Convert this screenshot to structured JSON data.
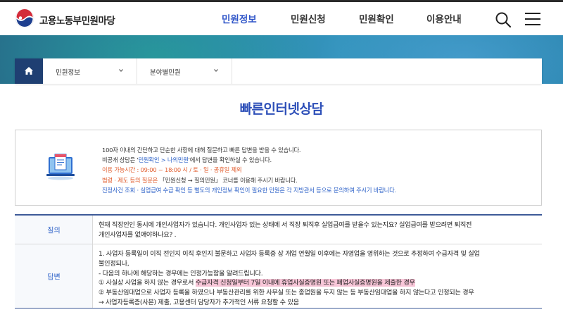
{
  "header": {
    "site_name": "고용노동부민원마당",
    "nav": [
      {
        "label": "민원정보",
        "active": true
      },
      {
        "label": "민원신청",
        "active": false
      },
      {
        "label": "민원확인",
        "active": false
      },
      {
        "label": "이용안내",
        "active": false
      }
    ],
    "search_icon": "search-icon",
    "menu_icon": "hamburger-menu-icon"
  },
  "breadcrumb": {
    "home_icon": "home-icon",
    "level1": "민원정보",
    "level2": "분야별민원"
  },
  "page": {
    "title": "빠른인터넷상담"
  },
  "info": {
    "line1": "100자 이내의 간단하고 단순한 사항에 대해 질문하고 빠른 답변을 받을 수 있습니다.",
    "line2_pre": "비공개 상담은 '",
    "line2_link": "민원확인 > 나의민원",
    "line2_post": "'에서 답변을 확인하실 수 있습니다.",
    "line3": "이용 가능시간 : 09:00 ~ 18:00 시 / 토 · 일 · 공휴일 제외",
    "line4_pre": "법령 · 제도 등의 질문은",
    "line4_post": " 「민원신청 → 질의민원」 코너를 이용해 주시기 바랍니다.",
    "line5": "진정사건 조회 · 실업급여 수급 확인 등 별도의 개인정보 확인이 필요한 민원은 각 지방관서 등으로 문의하여 주시기 바랍니다."
  },
  "qa": {
    "question_label": "질의",
    "question_lines": [
      "현재 직장인인 동시에 개인사업자가 있습니다. 개인사업자 있는 상태에 서 직장 퇴직후 실업급여를 받을수 있는지요? 실업급여를 받으려면 퇴직전",
      "개인사업자를 없애야하나요? ."
    ],
    "answer_label": "답변",
    "answer_lines": [
      "1. 사업자 등록일이 이직 전인지 이직 후인지 불문하고 사업자 등록증 상 개업 연월일 이후에는 자영업을 영위하는 것으로 추정하여 수급자격 및 실업",
      "불인정되나,",
      "- 다음의 하나에 해당하는 경우에는 인정가능함을 알려드립니다."
    ],
    "answer_line4_pre": "① 사실상 사업을 하지 않는 경우로서 ",
    "answer_line4_highlight": "수급자격 신청일부터 7일 이내에 휴업사실증명원 또는 폐업사실증명원을 제출한 경우",
    "answer_lines_after": [
      "② 부동산임대업으로 사업자 등록을 하였으나 부동산관리를 위한 사무실 또는 종업원을 두지 않는 등 부동산임대업을 하지 않는다고 인정되는 경우",
      "→ 사업자등록증(사본) 제출, 고용센터 담당자가 추가적인 서류 요청할 수 있음"
    ]
  },
  "colors": {
    "accent": "#2f55c8",
    "home_button": "#1f3f72",
    "table_border": "#3d5a98",
    "highlight": "#f8c6d8",
    "warning": "#e05a2a"
  }
}
